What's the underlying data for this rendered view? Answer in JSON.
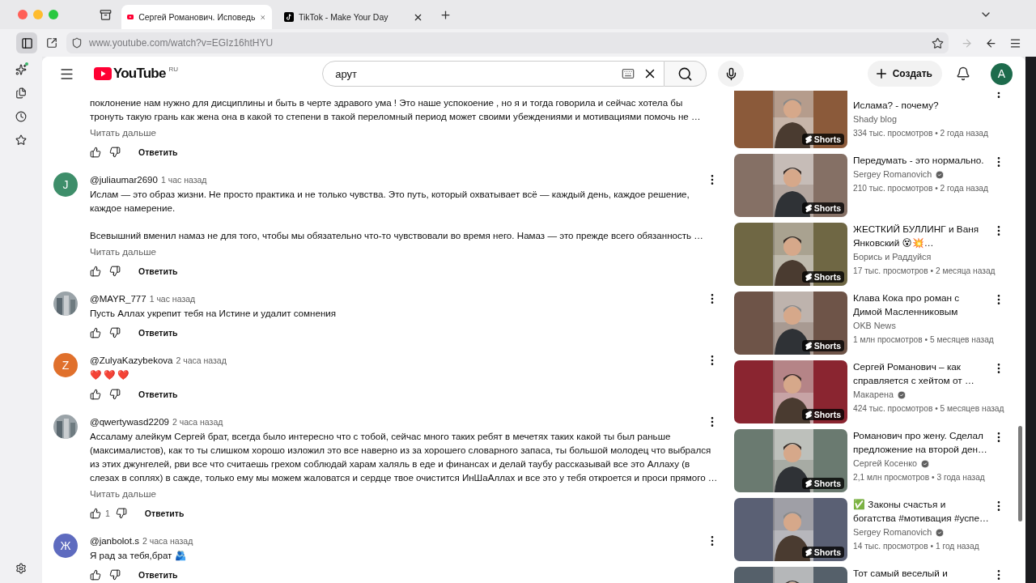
{
  "browser": {
    "tabs": [
      {
        "title": "Сергей Романович. Исповедь",
        "selected": true
      },
      {
        "title": "TikTok - Make Your Day",
        "selected": false
      }
    ],
    "url": "www.youtube.com/watch?v=EGIz16htHYU"
  },
  "header": {
    "logo": "YouTube",
    "region": "RU",
    "search": {
      "value": "арут"
    },
    "create": "Создать",
    "avatar": "A"
  },
  "comments": [
    {
      "paragraphs": [
        [
          "поклонение нам нужно для дисциплины и быть в черте здравого ума ! Это наше успокоение , но я и тогда говорила и сейчас хотела бы",
          "тронуть такую грань как жена она в какой то степени в такой переломный период может своими убеждениями и мотивациями помочь не …"
        ]
      ],
      "read_more": "Читать дальше",
      "reply": "Ответить"
    },
    {
      "avatar": {
        "kind": "letter",
        "letter": "J",
        "color": "#3e8e6a"
      },
      "author": "@juliaumar2690",
      "time": "1 час назад",
      "paragraphs": [
        [
          "Ислам — это образ жизни. Не просто практика и не только чувства. Это путь, который охватывает всё — каждый день, каждое решение,",
          "каждое намерение."
        ],
        [
          "Всевышний вменил намаз не для того, чтобы мы обязательно что-то чувствовали во время него. Намаз — это прежде всего обязанность …"
        ]
      ],
      "read_more": "Читать дальше",
      "reply": "Ответить"
    },
    {
      "avatar": {
        "kind": "picture"
      },
      "author": "@MAYR_777",
      "time": "1 час назад",
      "paragraphs": [
        [
          "Пусть Аллах укрепит тебя на Истине и удалит сомнения"
        ]
      ],
      "reply": "Ответить"
    },
    {
      "avatar": {
        "kind": "letter",
        "letter": "Z",
        "color": "#e0702c"
      },
      "author": "@ZulyaKazybekova",
      "time": "2 часа назад",
      "paragraphs": [
        [
          "❤️ ❤️ ❤️"
        ]
      ],
      "reply": "Ответить"
    },
    {
      "avatar": {
        "kind": "picture"
      },
      "author": "@qwertywasd2209",
      "time": "2 часа назад",
      "paragraphs": [
        [
          "Ассаламу алейкум Сергей брат, всегда было интересно что с тобой, сейчас много таких ребят в мечетях таких какой ты был раньше",
          "(максималистов), как то ты слишком хорошо изложил это все наверно из за хорошего словарного запаса, ты большой молодец что выбрался",
          "из этих джунгелей, рви все что считаешь грехом соблюдай харам халяль в еде и финансах и делай таубу рассказывай все это Аллаху (в",
          "слезах в соплях) в сажде, только ему мы можем жаловатся и сердце твое очистится ИнШаАллах и все это у тебя откроется и проси прямого …"
        ]
      ],
      "read_more": "Читать дальше",
      "likes": "1",
      "reply": "Ответить"
    },
    {
      "avatar": {
        "kind": "letter",
        "letter": "Ж",
        "color": "#5e6bbf"
      },
      "author": "@janbolot.s",
      "time": "2 часа назад",
      "paragraphs": [
        [
          "Я рад за тебя,брат 🫂"
        ]
      ],
      "reply": "Ответить"
    }
  ],
  "related": [
    {
      "title": "Ислама? - почему?",
      "channel": "Shady blog",
      "verified": false,
      "meta": "334 тыс. просмотров • 2 года назад",
      "badge": "Shorts"
    },
    {
      "title": "Передумать - это нормально.",
      "channel": "Sergey Romanovich",
      "verified": true,
      "meta": "210 тыс. просмотров • 2 года назад",
      "badge": "Shorts"
    },
    {
      "title": "ЖЕСТКИЙ БУЛЛИНГ и Ваня Янковский 😵💥…",
      "channel": "Борись и Раддуйся",
      "verified": false,
      "meta": "17 тыс. просмотров • 2 месяца назад",
      "badge": "Shorts"
    },
    {
      "title": "Клава Кока про роман с Димой Масленниковым",
      "channel": "OKB News",
      "verified": false,
      "meta": "1 млн просмотров • 5 месяцев назад",
      "badge": "Shorts"
    },
    {
      "title": "Сергей Романович – как справляется с хейтом от …",
      "channel": "Макарена",
      "verified": true,
      "meta": "424 тыс. просмотров • 5 месяцев назад",
      "badge": "Shorts"
    },
    {
      "title": "Романович про жену. Сделал предложение на второй ден…",
      "channel": "Сергей Косенко",
      "verified": true,
      "meta": "2,1 млн просмотров • 3 года назад",
      "badge": "Shorts"
    },
    {
      "title": "✅ Законы счастья и богатства #мотивация #успе…",
      "channel": "Sergey Romanovich",
      "verified": true,
      "meta": "14 тыс. просмотров • 1 год назад",
      "badge": "Shorts"
    },
    {
      "title": "Тот самый веселый и"
    }
  ]
}
